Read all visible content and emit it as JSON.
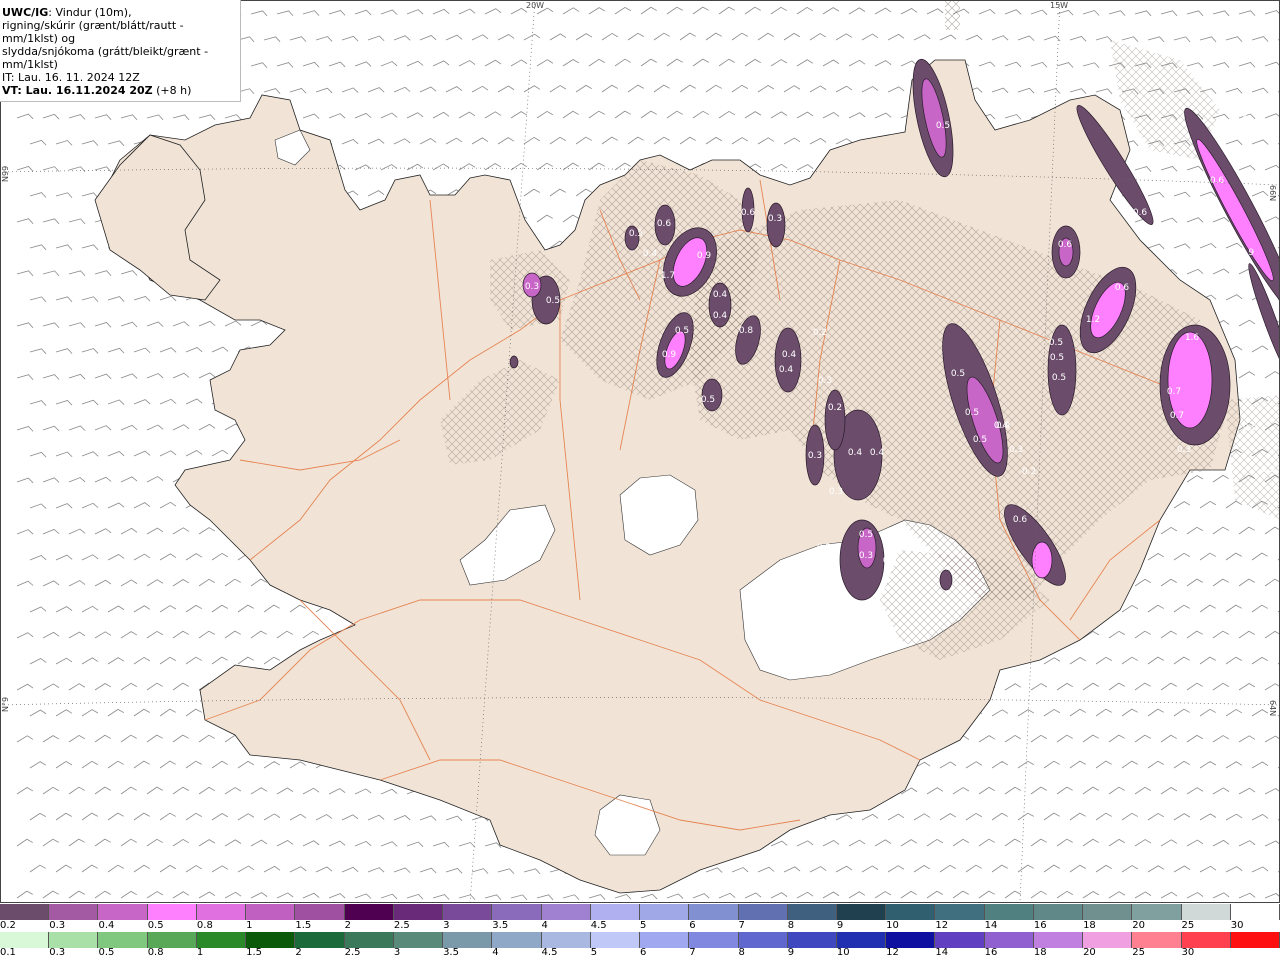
{
  "legend": {
    "line1_bold": "UWC/IG",
    "line1_rest": ": Vindur (10m),",
    "line2": "rigning/skúrir (grænt/blátt/rautt - mm/1klst) og",
    "line3": "slydda/snjókoma (grátt/bleikt/grænt - mm/1klst)",
    "line4": "IT: Lau. 16. 11. 2024 12Z",
    "line5_bold": "VT: Lau. 16.11.2024 20Z",
    "line5_rest": " (+8 h)"
  },
  "geo_labels": [
    "20W",
    "15W",
    "66N",
    "64N",
    "N99",
    "N°9"
  ],
  "precip_values": [
    "0.5",
    "0.3",
    "0.6",
    "0.9",
    "0.5",
    "0.5",
    "0.4",
    "1.7",
    "0.9",
    "0.4",
    "0.4",
    "0.5",
    "0.8",
    "0.6",
    "0.4",
    "0.4",
    "0.5",
    "0.3",
    "0.5",
    "0.2",
    "0.3",
    "0.2",
    "0.4",
    "0.4",
    "0.3",
    "0.3",
    "0.5",
    "0.3",
    "0.2",
    "0.2",
    "0.6",
    "0.6",
    "1.2",
    "0.5",
    "0.5",
    "0.5",
    "0.5",
    "0.4",
    "0.5",
    "0.3",
    "0.2",
    "0.6",
    "0.6",
    "1.6",
    "0.7",
    "0.7",
    "0.3",
    "0.5",
    "0.3",
    "0.3",
    "0.6",
    "0.4",
    "0.9",
    "0.4"
  ],
  "snow_scale": {
    "labels": [
      "0.2",
      "0.3",
      "0.4",
      "0.5",
      "0.8",
      "1",
      "1.5",
      "2",
      "2.5",
      "3",
      "3.5",
      "4",
      "4.5",
      "5",
      "6",
      "7",
      "8",
      "9",
      "10",
      "12",
      "14",
      "16",
      "18",
      "20",
      "25",
      "30"
    ],
    "colors": [
      "#6b4d6b",
      "#a35aa3",
      "#c766c7",
      "#ff80ff",
      "#e070e0",
      "#c060c0",
      "#a050a0",
      "#500050",
      "#6a2a7a",
      "#7a4a9a",
      "#8a6aba",
      "#a080d0",
      "#b0b0f0",
      "#a0a8e8",
      "#8090d0",
      "#6070b0",
      "#406080",
      "#204050",
      "#306070",
      "#407080",
      "#508080",
      "#608888",
      "#709090",
      "#80a0a0",
      "#d0d8d8",
      "#ffffff"
    ]
  },
  "rain_scale": {
    "labels": [
      "0.1",
      "0.3",
      "0.5",
      "0.8",
      "1",
      "1.5",
      "2",
      "2.5",
      "3",
      "3.5",
      "4",
      "4.5",
      "5",
      "6",
      "7",
      "8",
      "9",
      "10",
      "12",
      "14",
      "16",
      "18",
      "20",
      "25",
      "30"
    ],
    "colors": [
      "#d8f8d8",
      "#a8e0a8",
      "#80c880",
      "#58a858",
      "#2a8a2a",
      "#0a5a0a",
      "#1a6a3a",
      "#3a7a5a",
      "#5a8a7a",
      "#7a9aaa",
      "#90a8c8",
      "#a8b8e0",
      "#c0c8f8",
      "#a0a8f0",
      "#8088e0",
      "#6068d0",
      "#4048c0",
      "#2030b0",
      "#1010a0",
      "#6040c0",
      "#9060d0",
      "#c080e0",
      "#f0a0e0",
      "#ff8090",
      "#ff4050",
      "#ff1010"
    ]
  }
}
